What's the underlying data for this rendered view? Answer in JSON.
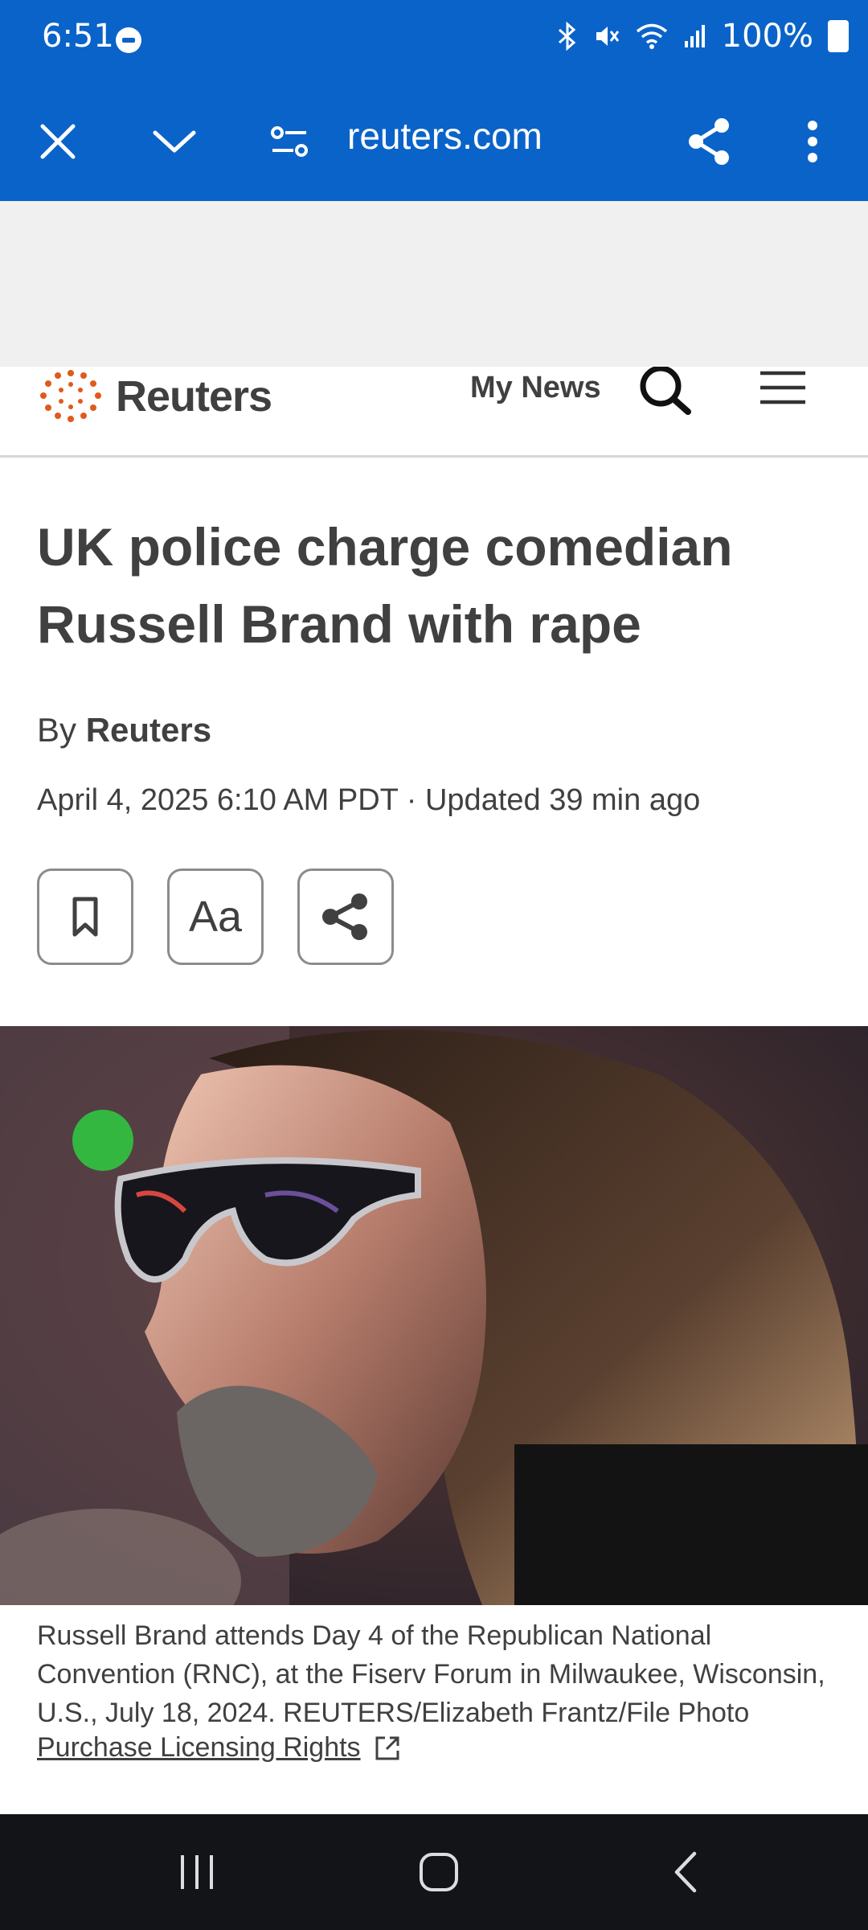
{
  "status_bar": {
    "time": "6:51",
    "battery": "100%",
    "icons": [
      "do-not-disturb-icon",
      "bluetooth-icon",
      "mute-icon",
      "wifi-icon",
      "signal-icon",
      "battery-icon"
    ]
  },
  "browser_bar": {
    "url": "reuters.com",
    "icons": [
      "close-icon",
      "chevron-down-icon",
      "site-settings-icon",
      "share-icon",
      "more-vert-icon"
    ],
    "color": "#0a63c9"
  },
  "site_header": {
    "logo_text": "Reuters",
    "my_news_label": "My News",
    "icons": [
      "reuters-logo-icon",
      "search-icon",
      "menu-icon"
    ],
    "logo_color": "#e05a1c"
  },
  "article": {
    "headline": "UK police charge comedian Russell Brand with rape",
    "byline_prefix": "By",
    "byline_author": "Reuters",
    "dateline": "April 4, 2025 6:10 AM PDT · Updated 39 min ago",
    "actions": {
      "bookmark_icon": "bookmark-icon",
      "text_size_label": "Aa",
      "share_icon": "share-icon"
    },
    "photo_caption": "Russell Brand attends Day 4 of the Republican National Convention (RNC), at the Fiserv Forum in Milwaukee, Wisconsin, U.S., July 18, 2024. REUTERS/Elizabeth Frantz/File Photo",
    "licensing_label": "Purchase Licensing Rights"
  },
  "nav_bar": {
    "icons": [
      "recent-apps-icon",
      "home-icon",
      "back-icon"
    ]
  }
}
